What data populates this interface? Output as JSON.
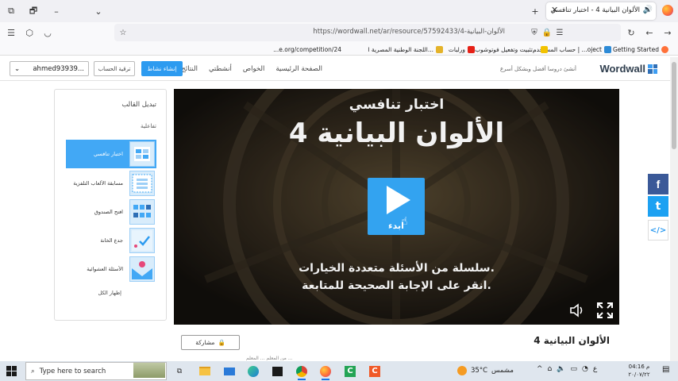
{
  "browser": {
    "tab_title": "الألوان البيانية 4 - اختبار تنافسي",
    "url": "https://wordwall.net/ar/resource/57592433/4-الألوان-البيانية",
    "bookmarks": [
      "Getting Started",
      "حساب المستخدم | ...oject",
      "تثبيت وتفعيل فوتوشوب...",
      "ورلبات",
      "اللجنة الوطنية المصرية ا...",
      "...e.org/competition/24"
    ]
  },
  "wordwall": {
    "logo": "Wordwall",
    "tagline": "أنشئ دروسا أفضل وبشكل أسرع",
    "nav": [
      "الصفحة الرئيسية",
      "الخواص",
      "أنشطتي",
      "النتائج"
    ],
    "create_button": "إنشاء نشاط",
    "upgrade_button": "ترقية الحساب",
    "username": "ahmed93939..."
  },
  "template_panel": {
    "title": "تبديل القالب",
    "subtitle": "تفاعلية",
    "items": [
      {
        "label": "اختبار تنافسي",
        "icon": "quiz-icon",
        "selected": true
      },
      {
        "label": "مسابقة الألعاب التلفزية",
        "icon": "gameshow-icon",
        "selected": false
      },
      {
        "label": "افتح الصندوق",
        "icon": "open-box-icon",
        "selected": false
      },
      {
        "label": "جدع الخانة",
        "icon": "tickbox-icon",
        "selected": false
      },
      {
        "label": "الأسئلة العشوائية",
        "icon": "spin-quiz-icon",
        "selected": false
      }
    ],
    "show_all": "إظهار الكل"
  },
  "game": {
    "type": "اختبار تنافسي",
    "title": "الألوان البيانية 4",
    "start_label": "ابدء",
    "desc_line1": "سلسلة من الأسئلة متعددة الخيارات.",
    "desc_line2": "انقر على الإجابة الصحيحة للمتابعة."
  },
  "share_buttons": {
    "facebook": "f",
    "twitter": "t",
    "embed": "</>"
  },
  "below": {
    "activity_title": "الألوان البيانية 4",
    "share_label": "مشاركة",
    "meta": "من المعلم ... المعلم ..."
  },
  "taskbar": {
    "search_placeholder": "Type here to search",
    "temperature": "35°C",
    "weather_label": "مشمس",
    "time": "04:16 م",
    "date": "٢٠/٠٧/٢٢",
    "lang": "ع"
  },
  "colors": {
    "accent": "#2d9bf0",
    "selected_template": "#42a8f5",
    "stage_bg": "#1a1713",
    "facebook": "#3b5998",
    "twitter": "#1da1f2"
  }
}
